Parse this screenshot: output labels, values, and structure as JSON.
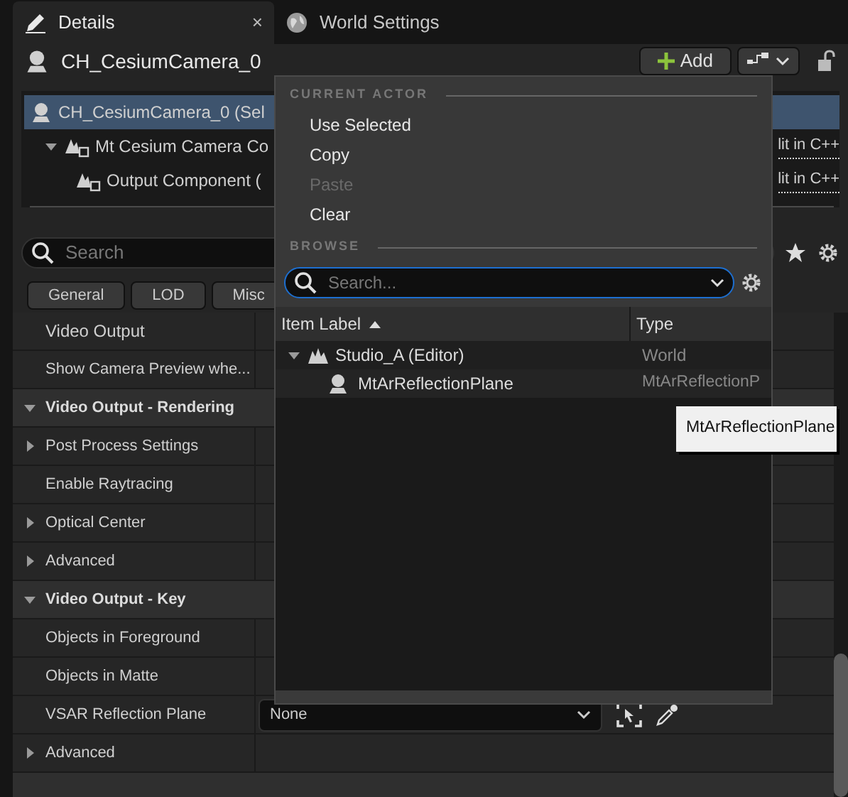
{
  "tabs": [
    {
      "label": "Details",
      "selected": true,
      "close": "×"
    },
    {
      "label": "World Settings",
      "selected": false
    }
  ],
  "header": {
    "actor": "CH_CesiumCamera_0",
    "add_button": "Add"
  },
  "components": [
    {
      "label": "CH_CesiumCamera_0 (Sel",
      "selected": true,
      "kind": "actor"
    },
    {
      "label": "Mt Cesium Camera Co",
      "selected": false,
      "kind": "component",
      "expanded": true,
      "link": "lit in C++",
      "children": [
        {
          "label": "Output Component (",
          "selected": false,
          "kind": "component",
          "link": "lit in C++"
        }
      ]
    }
  ],
  "search": {
    "placeholder": "Search"
  },
  "filters": [
    "General",
    "LOD",
    "Misc"
  ],
  "properties": [
    {
      "kind": "property",
      "label": "Video Output"
    },
    {
      "kind": "property",
      "label": "Show Camera Preview whe..."
    },
    {
      "kind": "category",
      "label": "Video Output - Rendering",
      "expanded": true
    },
    {
      "kind": "group",
      "label": "Post Process Settings",
      "expanded": false
    },
    {
      "kind": "property",
      "label": "Enable Raytracing"
    },
    {
      "kind": "group",
      "label": "Optical Center",
      "expanded": false
    },
    {
      "kind": "group",
      "label": "Advanced",
      "expanded": false
    },
    {
      "kind": "category",
      "label": "Video Output - Key",
      "expanded": true
    },
    {
      "kind": "property",
      "label": "Objects in Foreground"
    },
    {
      "kind": "property",
      "label": "Objects in Matte"
    },
    {
      "kind": "property",
      "label": "VSAR Reflection Plane",
      "value": "None"
    },
    {
      "kind": "group",
      "label": "Advanced",
      "expanded": false
    },
    {
      "kind": "category"
    }
  ],
  "popup": {
    "sections": [
      {
        "title": "CURRENT ACTOR",
        "items": [
          {
            "label": "Use Selected",
            "disabled": false
          },
          {
            "label": "Copy",
            "disabled": false
          },
          {
            "label": "Paste",
            "disabled": true
          },
          {
            "label": "Clear",
            "disabled": false
          }
        ]
      },
      {
        "title": "BROWSE"
      }
    ],
    "search": {
      "placeholder": "Search..."
    },
    "columns": [
      {
        "label": "Item Label",
        "sorted": true
      },
      {
        "label": "Type",
        "sorted": false
      }
    ],
    "rows": [
      {
        "label": "Studio_A (Editor)",
        "type": "World",
        "kind": "world",
        "expanded": true,
        "children": [
          {
            "label": "MtArReflectionPlane",
            "type": "MtArReflectionP",
            "kind": "actor"
          }
        ]
      }
    ]
  },
  "tooltip": "MtArReflectionPlane"
}
